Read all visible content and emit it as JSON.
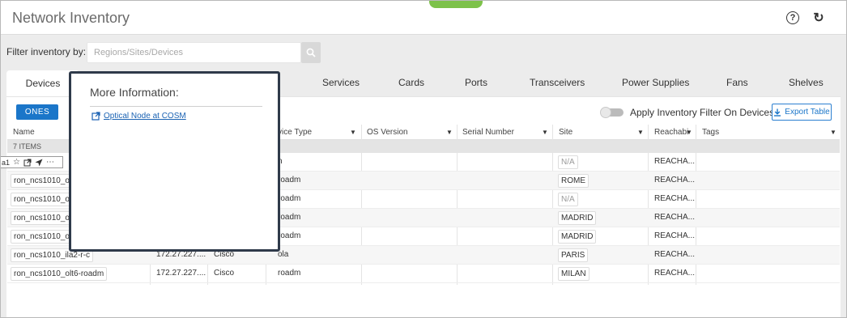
{
  "header": {
    "title": "Network Inventory",
    "help_icon": "help-icon",
    "refresh_icon": "refresh-icon"
  },
  "filter": {
    "label": "Filter inventory by:",
    "placeholder": "Regions/Sites/Devices",
    "button_icon": "search-icon"
  },
  "tabs": [
    {
      "label": "Devices",
      "active": true
    },
    {
      "label": "Services"
    },
    {
      "label": "Cards"
    },
    {
      "label": "Ports"
    },
    {
      "label": "Transceivers"
    },
    {
      "label": "Power Supplies"
    },
    {
      "label": "Fans"
    },
    {
      "label": "Shelves"
    }
  ],
  "toolbar": {
    "ones_label": "ONES",
    "toggle_label": "Apply Inventory Filter On Devices",
    "toggle_on": false,
    "export_label": "Export Table"
  },
  "table": {
    "columns": {
      "name": "Name",
      "device_type": "vice Type",
      "os_version": "OS Version",
      "serial_number": "Serial Number",
      "site": "Site",
      "reachability": "Reachabi",
      "tags": "Tags"
    },
    "items_count": "7 ITEMS",
    "rows": [
      {
        "name": "",
        "ip": "",
        "vendor": "",
        "type": "n",
        "site": "N/A",
        "reach": "REACHA..."
      },
      {
        "name": "ron_ncs1010_ol",
        "ip": "",
        "vendor": "",
        "type": "roadm",
        "site": "ROME",
        "reach": "REACHA..."
      },
      {
        "name": "ron_ncs1010_ol",
        "ip": "",
        "vendor": "",
        "type": "roadm",
        "site": "N/A",
        "reach": "REACHA..."
      },
      {
        "name": "ron_ncs1010_ol",
        "ip": "",
        "vendor": "",
        "type": "roadm",
        "site": "MADRID",
        "reach": "REACHA..."
      },
      {
        "name": "ron_ncs1010_ol",
        "ip": "",
        "vendor": "",
        "type": "roadm",
        "site": "MADRID",
        "reach": "REACHA..."
      },
      {
        "name": "ron_ncs1010_ila2-r-c",
        "ip": "172.27.227....",
        "vendor": "Cisco",
        "type": "ola",
        "site": "PARIS",
        "reach": "REACHA..."
      },
      {
        "name": "ron_ncs1010_olt6-roadm",
        "ip": "172.27.227....",
        "vendor": "Cisco",
        "type": "roadm",
        "site": "MILAN",
        "reach": "REACHA..."
      }
    ]
  },
  "row_toolbar": {
    "label": "a1"
  },
  "popup": {
    "title": "More Information:",
    "link_label": "Optical Node at COSM"
  },
  "colors": {
    "accent": "#1b76c9",
    "popup_border": "#2f3a4a",
    "green_tab": "#7dc24a"
  }
}
